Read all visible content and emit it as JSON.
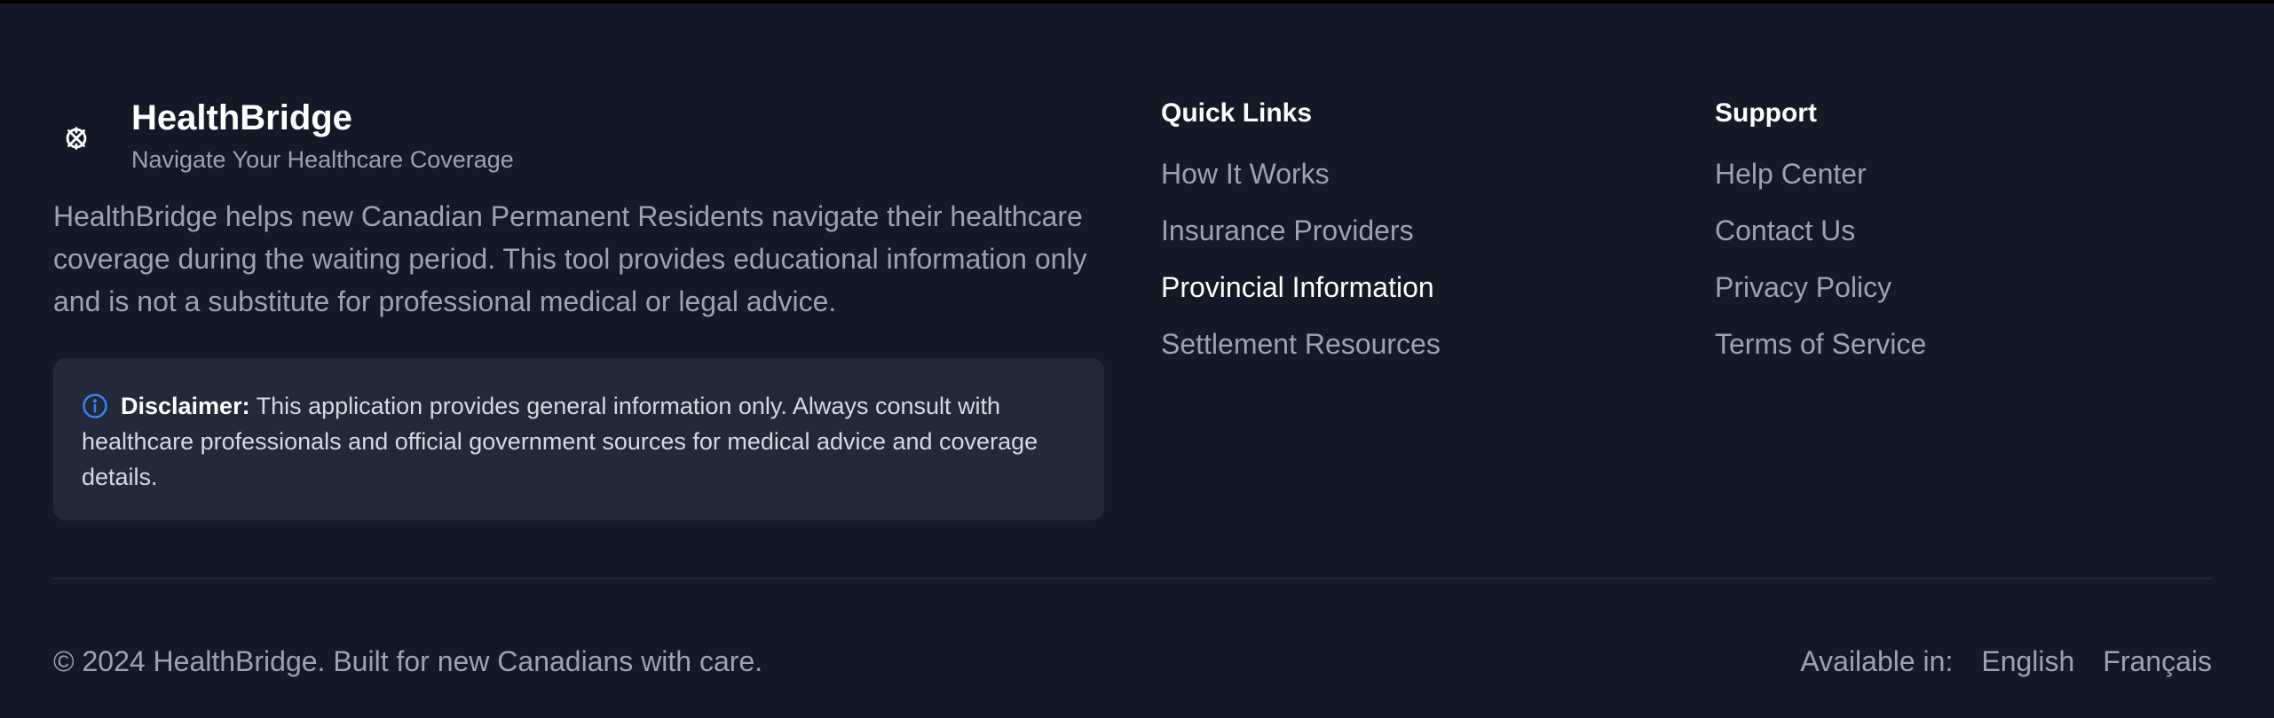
{
  "brand": {
    "name": "HealthBridge",
    "tagline": "Navigate Your Healthcare Coverage",
    "icon": "stethoscope-cross-icon",
    "description": "HealthBridge helps new Canadian Permanent Residents navigate their healthcare coverage during the waiting period. This tool provides educational information only and is not a substitute for professional medical or legal advice."
  },
  "disclaimer": {
    "icon": "info-icon",
    "label": "Disclaimer:",
    "text": " This application provides general information only. Always consult with healthcare professionals and official government sources for medical advice and coverage details."
  },
  "quick_links": {
    "heading": "Quick Links",
    "items": [
      "How It Works",
      "Insurance Providers",
      "Provincial Information",
      "Settlement Resources"
    ]
  },
  "support": {
    "heading": "Support",
    "items": [
      "Help Center",
      "Contact Us",
      "Privacy Policy",
      "Terms of Service"
    ]
  },
  "bottom": {
    "copyright": "© 2024 HealthBridge. Built for new Canadians with care.",
    "available_label": "Available in:",
    "languages": [
      "English",
      "Français"
    ]
  },
  "colors": {
    "background": "#131926",
    "panel": "#222938",
    "accent": "#3b82f6",
    "text_muted": "#9aa3b2",
    "text_strong": "#ffffff"
  }
}
